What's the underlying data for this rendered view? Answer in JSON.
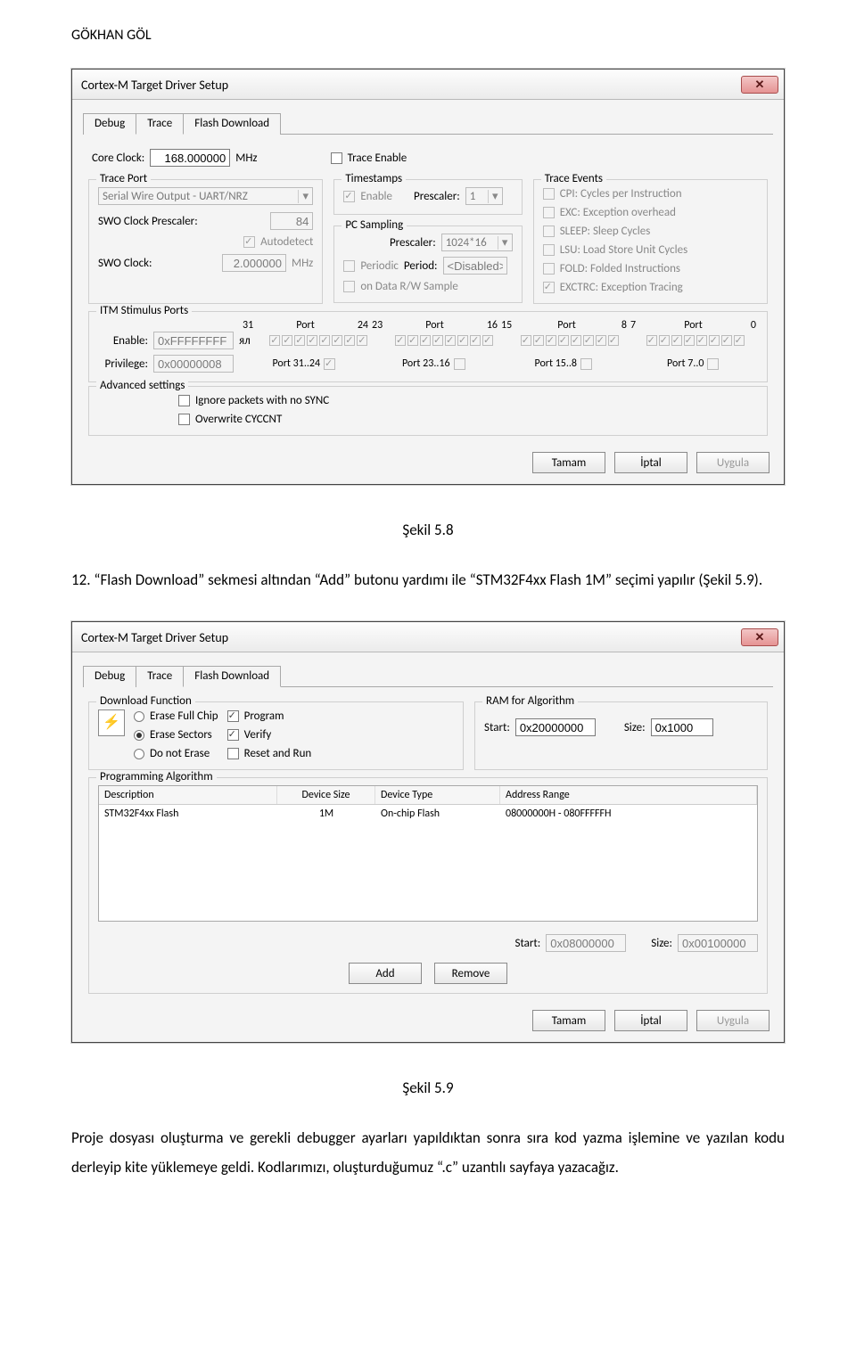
{
  "page": {
    "header": "GÖKHAN GÖL"
  },
  "dialog1": {
    "title": "Cortex-M Target Driver Setup",
    "tabs": [
      "Debug",
      "Trace",
      "Flash Download"
    ],
    "active_tab": "Trace",
    "core_clock_label": "Core Clock:",
    "core_clock_value": "168.000000",
    "mhz": "MHz",
    "trace_enable": "Trace Enable",
    "trace_port": {
      "legend": "Trace Port",
      "combo": "Serial Wire Output - UART/NRZ",
      "swo_presc_label": "SWO Clock Prescaler:",
      "swo_presc_value": "84",
      "autodetect": "Autodetect",
      "swo_clock_label": "SWO Clock:",
      "swo_clock_value": "2.000000"
    },
    "timestamps": {
      "legend": "Timestamps",
      "enable": "Enable",
      "prescaler_label": "Prescaler:",
      "prescaler_value": "1"
    },
    "pcsample": {
      "legend": "PC Sampling",
      "prescaler_label": "Prescaler:",
      "prescaler_value": "1024*16",
      "periodic": "Periodic",
      "period_label": "Period:",
      "period_value": "<Disabled>",
      "datarw": "on Data R/W Sample"
    },
    "events": {
      "legend": "Trace Events",
      "cpi": "CPI: Cycles per Instruction",
      "exc": "EXC: Exception overhead",
      "sleep": "SLEEP: Sleep Cycles",
      "lsu": "LSU: Load Store Unit Cycles",
      "fold": "FOLD: Folded Instructions",
      "exctrc": "EXCTRC: Exception Tracing"
    },
    "itm": {
      "legend": "ITM Stimulus Ports",
      "col_labels": [
        "31",
        "Port",
        "24",
        "23",
        "Port",
        "16",
        "15",
        "Port",
        "8",
        "7",
        "Port",
        "0"
      ],
      "enable_label": "Enable:",
      "enable_value": "0xFFFFFFFF",
      "priv_label": "Privilege:",
      "priv_value": "0x00000008",
      "g1_label": "Port 31..24",
      "g2_label": "Port 23..16",
      "g3_label": "Port 15..8",
      "g4_label": "Port 7..0"
    },
    "adv": {
      "legend": "Advanced settings",
      "ignore": "Ignore packets with no SYNC",
      "overwrite": "Overwrite CYCCNT"
    },
    "buttons": {
      "ok": "Tamam",
      "cancel": "İptal",
      "apply": "Uygula"
    }
  },
  "caption1": "Şekil 5.8",
  "para1": "12. “Flash Download” sekmesi altından “Add” butonu yardımı ile “STM32F4xx Flash 1M” seçimi yapılır (Şekil 5.9).",
  "dialog2": {
    "title": "Cortex-M Target Driver Setup",
    "tabs": [
      "Debug",
      "Trace",
      "Flash Download"
    ],
    "active_tab": "Flash Download",
    "dlfunc": {
      "legend": "Download Function",
      "efc": "Erase Full Chip",
      "es": "Erase Sectors",
      "dne": "Do not Erase",
      "prog": "Program",
      "verify": "Verify",
      "reset": "Reset and Run",
      "load": "LOAD"
    },
    "ram": {
      "legend": "RAM for Algorithm",
      "start_label": "Start:",
      "start_value": "0x20000000",
      "size_label": "Size:",
      "size_value": "0x1000"
    },
    "prog": {
      "legend": "Programming Algorithm",
      "th_desc": "Description",
      "th_size": "Device Size",
      "th_type": "Device Type",
      "th_range": "Address Range",
      "row_desc": "STM32F4xx Flash",
      "row_size": "1M",
      "row_type": "On-chip Flash",
      "row_range": "08000000H - 080FFFFFH",
      "start_label": "Start:",
      "start_value": "0x08000000",
      "size_label": "Size:",
      "size_value": "0x00100000",
      "add": "Add",
      "remove": "Remove"
    },
    "buttons": {
      "ok": "Tamam",
      "cancel": "İptal",
      "apply": "Uygula"
    }
  },
  "caption2": "Şekil 5.9",
  "para2": "Proje dosyası oluşturma ve gerekli debugger ayarları yapıldıktan sonra sıra kod yazma işlemine ve yazılan kodu derleyip kite yüklemeye geldi. Kodlarımızı, oluşturduğumuz “.c” uzantılı sayfaya yazacağız."
}
